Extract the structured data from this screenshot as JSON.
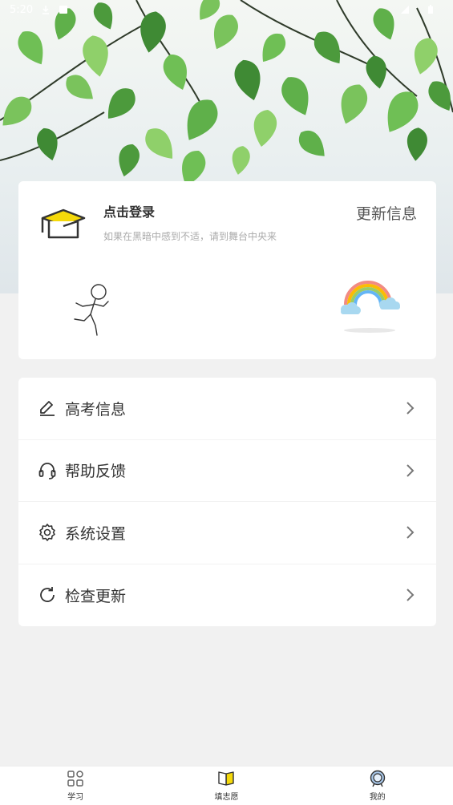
{
  "status_bar": {
    "time": "5:20"
  },
  "profile": {
    "login_title": "点击登录",
    "login_subtitle": "如果在黑暗中感到不适，请到舞台中央来",
    "update_link": "更新信息"
  },
  "menu": [
    {
      "label": "高考信息",
      "icon": "pencil-icon"
    },
    {
      "label": "帮助反馈",
      "icon": "headset-icon"
    },
    {
      "label": "系统设置",
      "icon": "gear-icon"
    },
    {
      "label": "检查更新",
      "icon": "refresh-icon"
    }
  ],
  "tabs": [
    {
      "label": "学习",
      "icon": "grid-icon"
    },
    {
      "label": "填志愿",
      "icon": "book-icon"
    },
    {
      "label": "我的",
      "icon": "medal-icon",
      "active": true
    }
  ],
  "colors": {
    "accent_yellow": "#f5d90a",
    "leaf_green": "#5fb04a",
    "background": "#f1f1f1"
  }
}
